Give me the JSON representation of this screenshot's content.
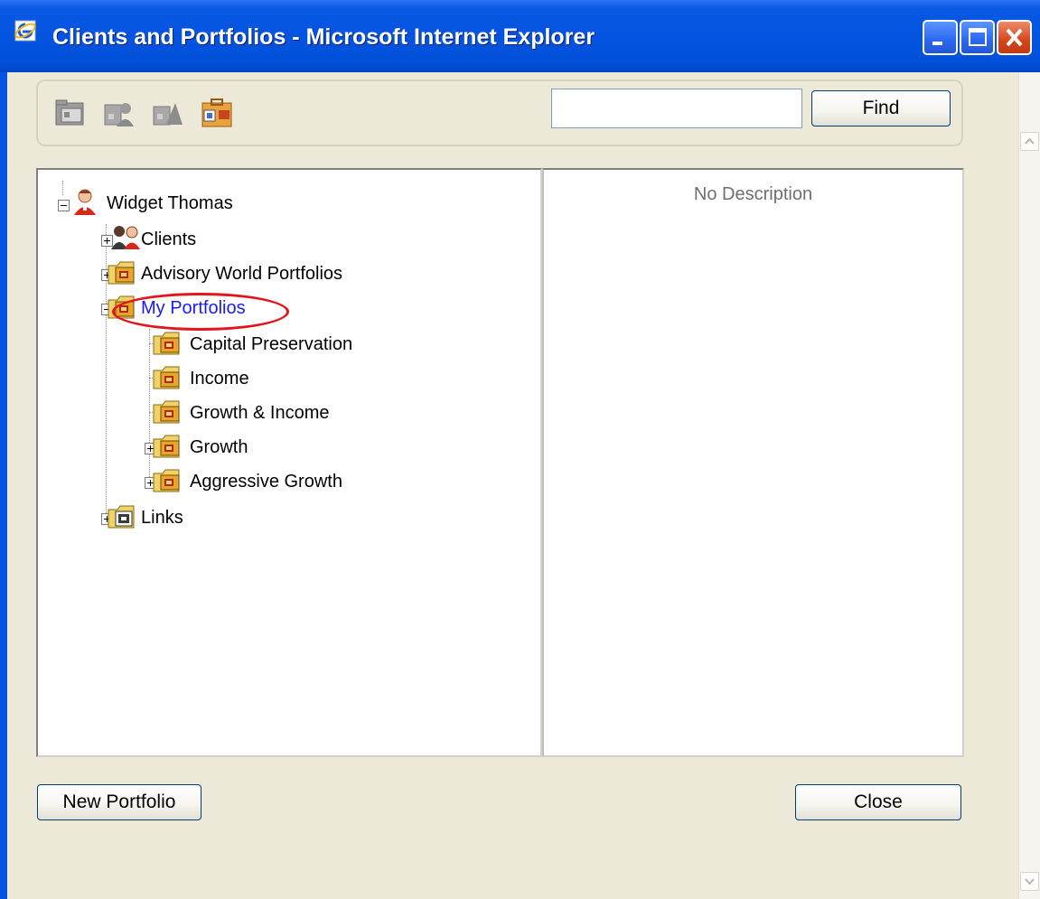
{
  "window": {
    "title": "Clients and Portfolios - Microsoft Internet Explorer"
  },
  "search": {
    "value": "",
    "placeholder": "",
    "find_label": "Find"
  },
  "toolbar_icons": [
    "folder-icon",
    "client-icon",
    "alert-icon",
    "portfolio-icon"
  ],
  "tree": {
    "root": "Widget Thomas",
    "clients": "Clients",
    "advisory": "Advisory World Portfolios",
    "my_portfolios": "My Portfolios",
    "capital": "Capital Preservation",
    "income": "Income",
    "growth_income": "Growth & Income",
    "growth": "Growth",
    "aggressive": "Aggressive Growth",
    "links": "Links"
  },
  "description": {
    "text": "No Description"
  },
  "buttons": {
    "new_portfolio": "New Portfolio",
    "close": "Close"
  },
  "colors": {
    "selected_text": "#1a1aff",
    "highlight": "#e3141c",
    "titlebar": "#0454e1"
  }
}
